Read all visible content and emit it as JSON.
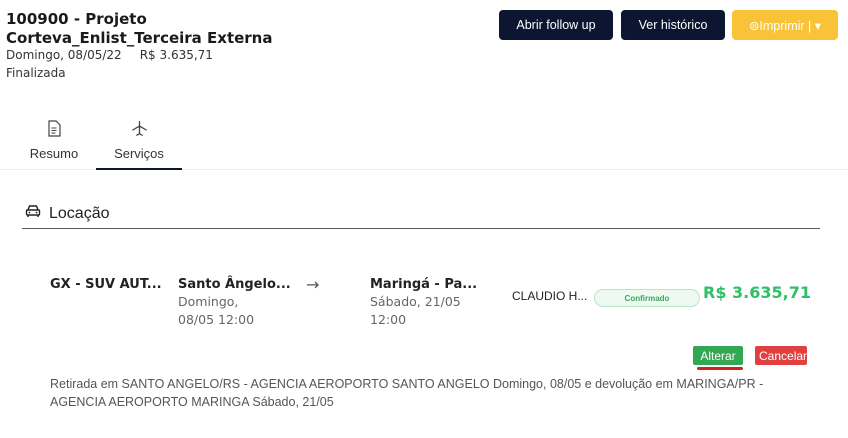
{
  "header": {
    "title": "100900 - Projeto Corteva_Enlist_Terceira Externa",
    "date": "Domingo, 08/05/22",
    "price": "R$ 3.635,71",
    "status": "Finalizada"
  },
  "actions": {
    "followup": "Abrir follow up",
    "history": "Ver histórico",
    "print": "⊜Imprimir | ▾"
  },
  "tabs": [
    {
      "label": "Resumo",
      "icon": "document-icon"
    },
    {
      "label": "Serviços",
      "icon": "airplane-icon"
    }
  ],
  "section": {
    "title": "Locação",
    "icon": "car-icon"
  },
  "booking": {
    "car": "GX - SUV AUT...",
    "from_city": "Santo Ângelo...",
    "from_date_line1": "Domingo,",
    "from_date_line2": "08/05 12:00",
    "arrow": "→",
    "to_city": "Maringá - Pa...",
    "to_date_line1": "Sábado, 21/05",
    "to_date_line2": "12:00",
    "traveler": "CLAUDIO H...",
    "status": "Confirmado",
    "price": "R$ 3.635,71",
    "alter": "Alterar",
    "cancel": "Cancelar",
    "description": "Retirada em SANTO ANGELO/RS - AGENCIA AEROPORTO SANTO ANGELO Domingo, 08/05 e devolução em MARINGA/PR - AGENCIA AEROPORTO MARINGA Sábado, 21/05"
  },
  "colors": {
    "dark": "#0c1630",
    "print": "#f8c336",
    "green": "#2fbf66",
    "alter": "#33a853",
    "cancel": "#e04040"
  }
}
